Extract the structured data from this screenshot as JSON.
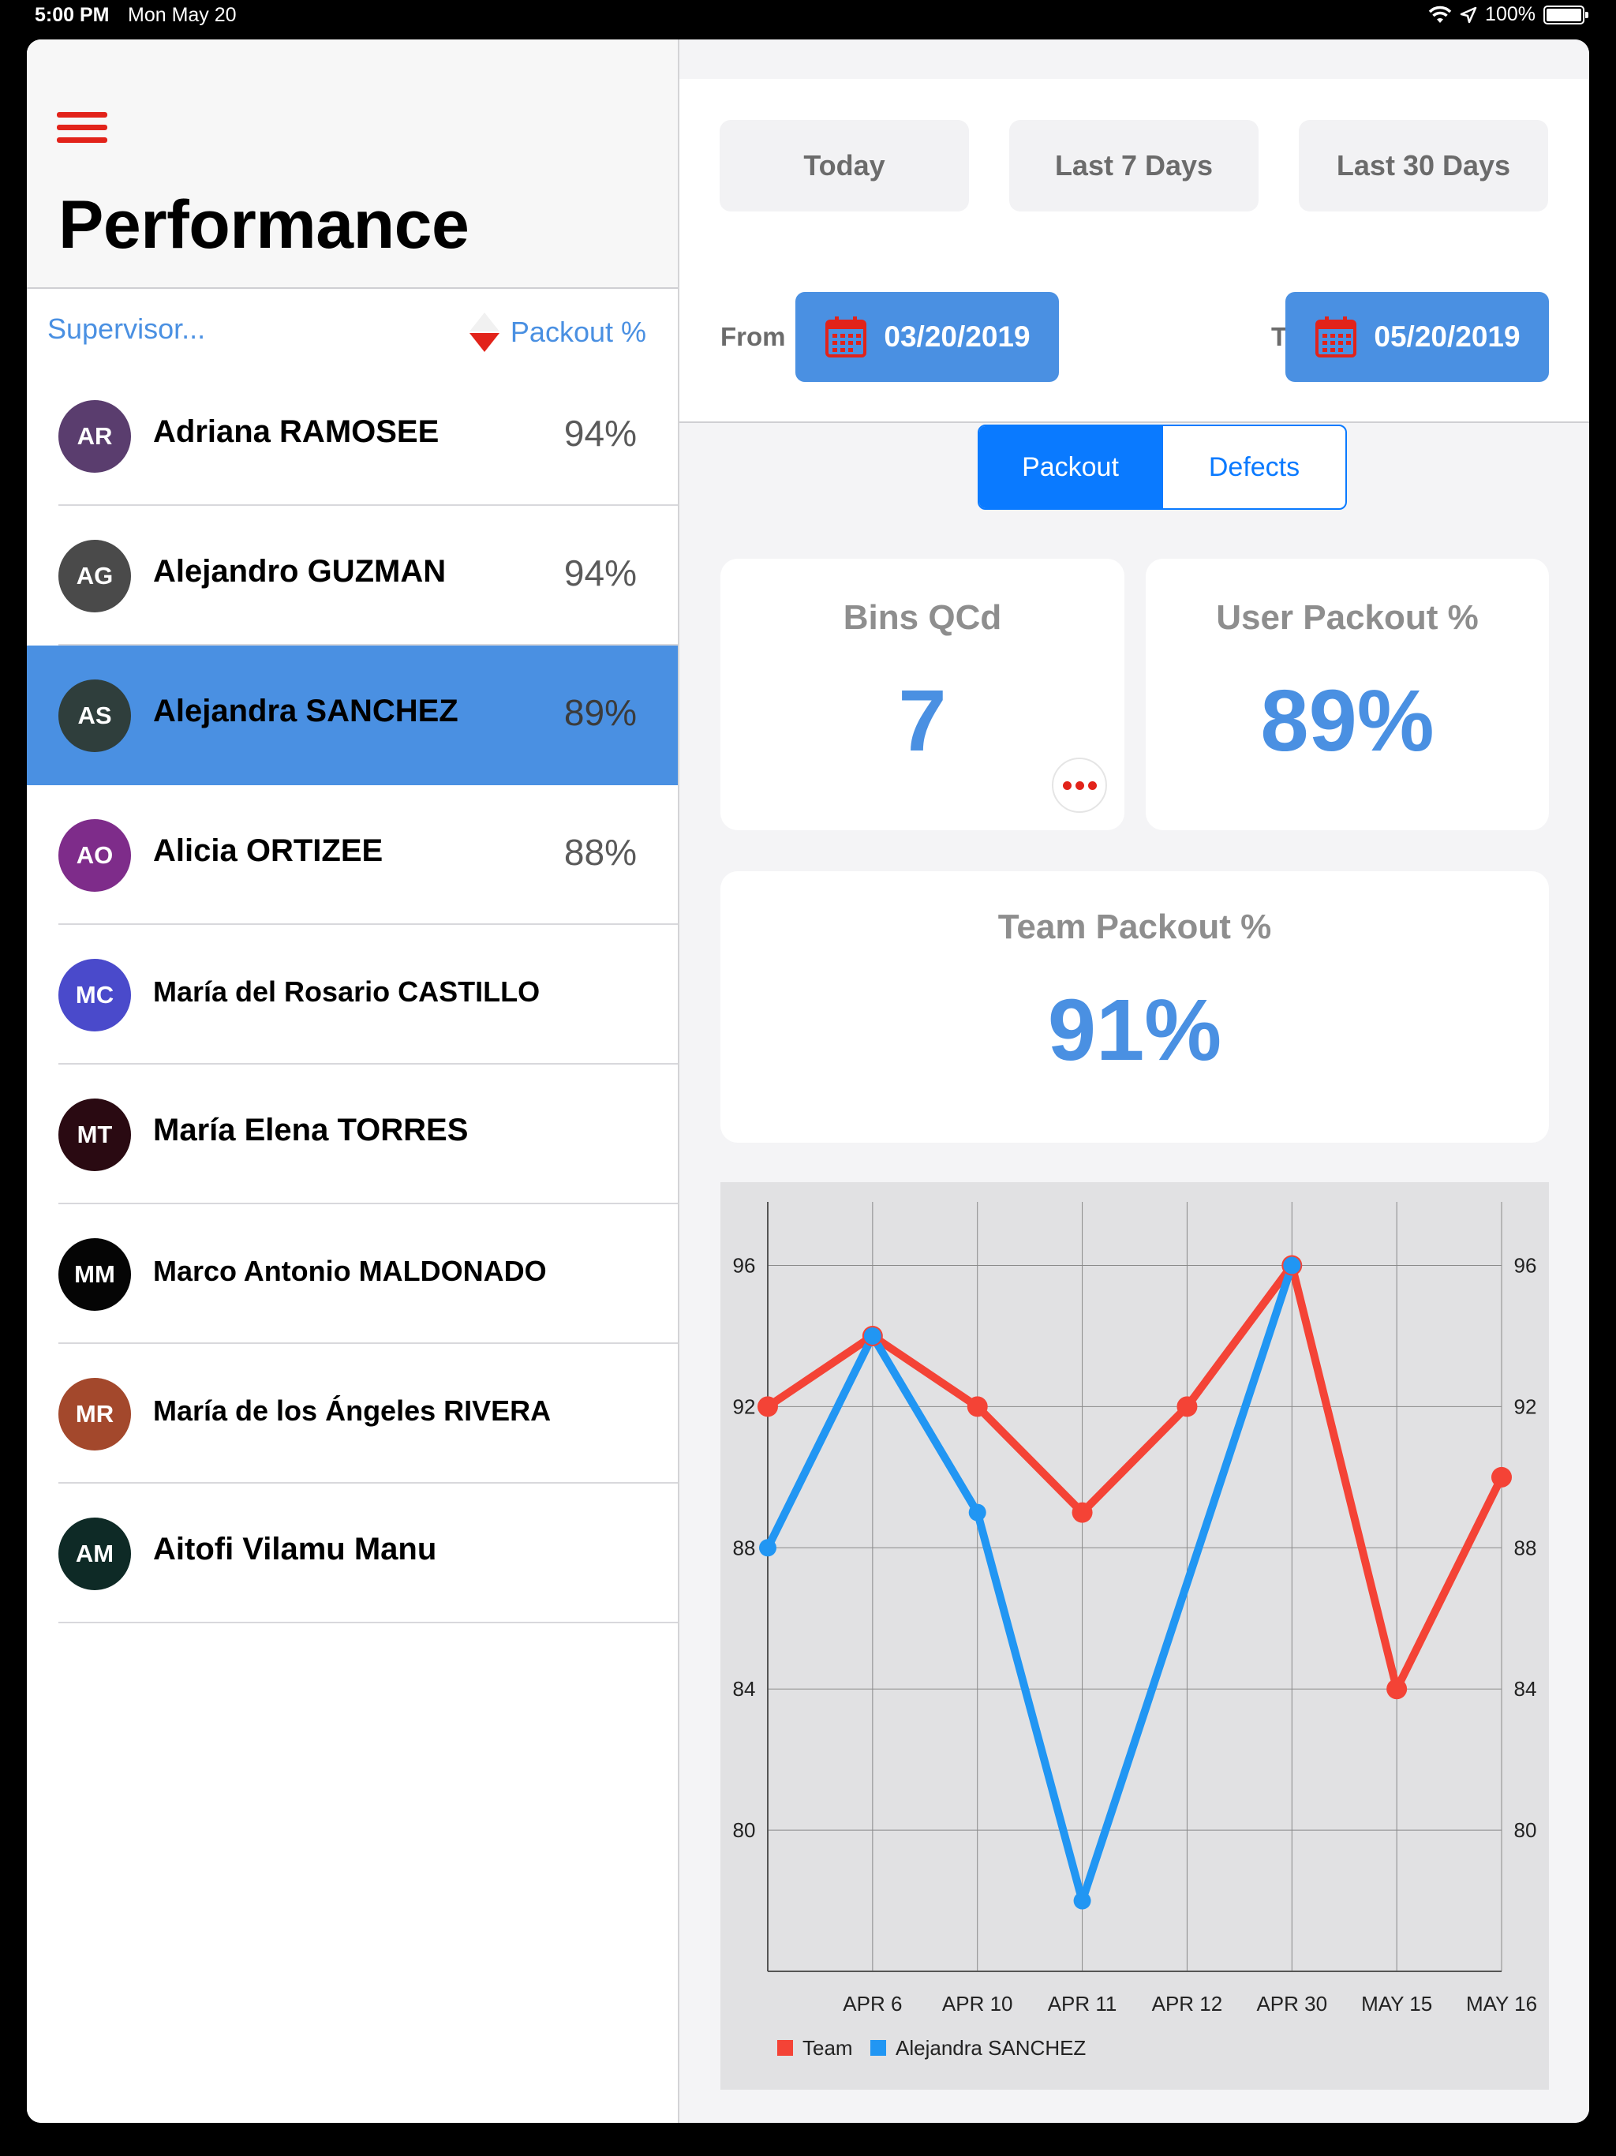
{
  "status": {
    "time": "5:00 PM",
    "date": "Mon May 20",
    "battery": "100%"
  },
  "sidebar": {
    "title": "Performance",
    "supervisor_label": "Supervisor...",
    "sort_label": "Packout %",
    "items": [
      {
        "initials": "AR",
        "name": "Adriana RAMOSEE",
        "pct": "94%",
        "color": "#5a3d6e"
      },
      {
        "initials": "AG",
        "name": "Alejandro GUZMAN",
        "pct": "94%",
        "color": "#4a4a4a"
      },
      {
        "initials": "AS",
        "name": "Alejandra SANCHEZ",
        "pct": "89%",
        "color": "#2f3e3c",
        "selected": true
      },
      {
        "initials": "AO",
        "name": "Alicia ORTIZEE",
        "pct": "88%",
        "color": "#7e2c8a"
      },
      {
        "initials": "MC",
        "name": "María del Rosario CASTILLO",
        "pct": "",
        "color": "#4a4acb"
      },
      {
        "initials": "MT",
        "name": "María Elena TORRES",
        "pct": "",
        "color": "#2a0a12"
      },
      {
        "initials": "MM",
        "name": "Marco Antonio MALDONADO",
        "pct": "",
        "color": "#050505"
      },
      {
        "initials": "MR",
        "name": "María de los Ángeles RIVERA",
        "pct": "",
        "color": "#a3482c"
      },
      {
        "initials": "AM",
        "name": "Aitofi Vilamu Manu",
        "pct": "",
        "color": "#0e2a26"
      }
    ]
  },
  "filters": {
    "today": "Today",
    "last7": "Last 7 Days",
    "last30": "Last 30 Days",
    "from_label": "From",
    "from_date": "03/20/2019",
    "to_label": "To",
    "to_date": "05/20/2019"
  },
  "tabs": {
    "packout": "Packout",
    "defects": "Defects"
  },
  "cards": {
    "bins_label": "Bins QCd",
    "bins_value": "7",
    "user_label": "User Packout %",
    "user_value": "89%",
    "team_label": "Team Packout %",
    "team_value": "91%"
  },
  "chart_data": {
    "type": "line",
    "categories": [
      "",
      "APR 6",
      "APR 10",
      "APR 11",
      "APR 12",
      "APR 30",
      "MAY 15",
      "MAY 16"
    ],
    "series": [
      {
        "name": "Team",
        "color": "#f44336",
        "values": [
          92,
          94,
          92,
          89,
          92,
          96,
          84,
          90
        ]
      },
      {
        "name": "Alejandra SANCHEZ",
        "color": "#2196f3",
        "values": [
          88,
          94,
          89,
          78,
          null,
          96,
          null,
          null
        ]
      }
    ],
    "y_ticks": [
      80,
      84,
      88,
      92,
      96
    ],
    "ylim": [
      76,
      97.8
    ],
    "grid": true,
    "legend": "bottom-left"
  }
}
